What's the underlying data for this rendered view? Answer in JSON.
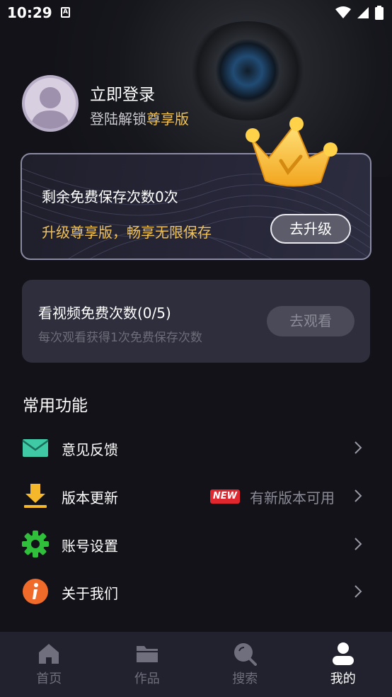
{
  "status_bar": {
    "time": "10:29",
    "notification_glyph": "A"
  },
  "profile": {
    "login_label": "立即登录",
    "subtitle_prefix": "登陆解锁",
    "subtitle_vip": "尊享版"
  },
  "vip_card": {
    "remaining_text": "剩余免费保存次数0次",
    "promo_text": "升级尊享版，畅享无限保存",
    "upgrade_button": "去升级"
  },
  "video_card": {
    "title": "看视频免费次数(0/5)",
    "subtitle": "每次观看获得1次免费保存次数",
    "watch_button": "去观看"
  },
  "section": {
    "title": "常用功能"
  },
  "menu": [
    {
      "label": "意见反馈",
      "icon": "mail-icon"
    },
    {
      "label": "版本更新",
      "icon": "download-icon",
      "badge": "NEW",
      "hint": "有新版本可用"
    },
    {
      "label": "账号设置",
      "icon": "gear-icon"
    },
    {
      "label": "关于我们",
      "icon": "info-icon"
    }
  ],
  "tabs": [
    {
      "label": "首页",
      "icon": "home-icon",
      "active": false
    },
    {
      "label": "作品",
      "icon": "folder-icon",
      "active": false
    },
    {
      "label": "搜索",
      "icon": "search-icon",
      "active": false
    },
    {
      "label": "我的",
      "icon": "user-icon",
      "active": true
    }
  ],
  "colors": {
    "accent_gold": "#f3c254",
    "background": "#121218",
    "card": "#2e2e3c",
    "new_badge": "#e0262e"
  }
}
